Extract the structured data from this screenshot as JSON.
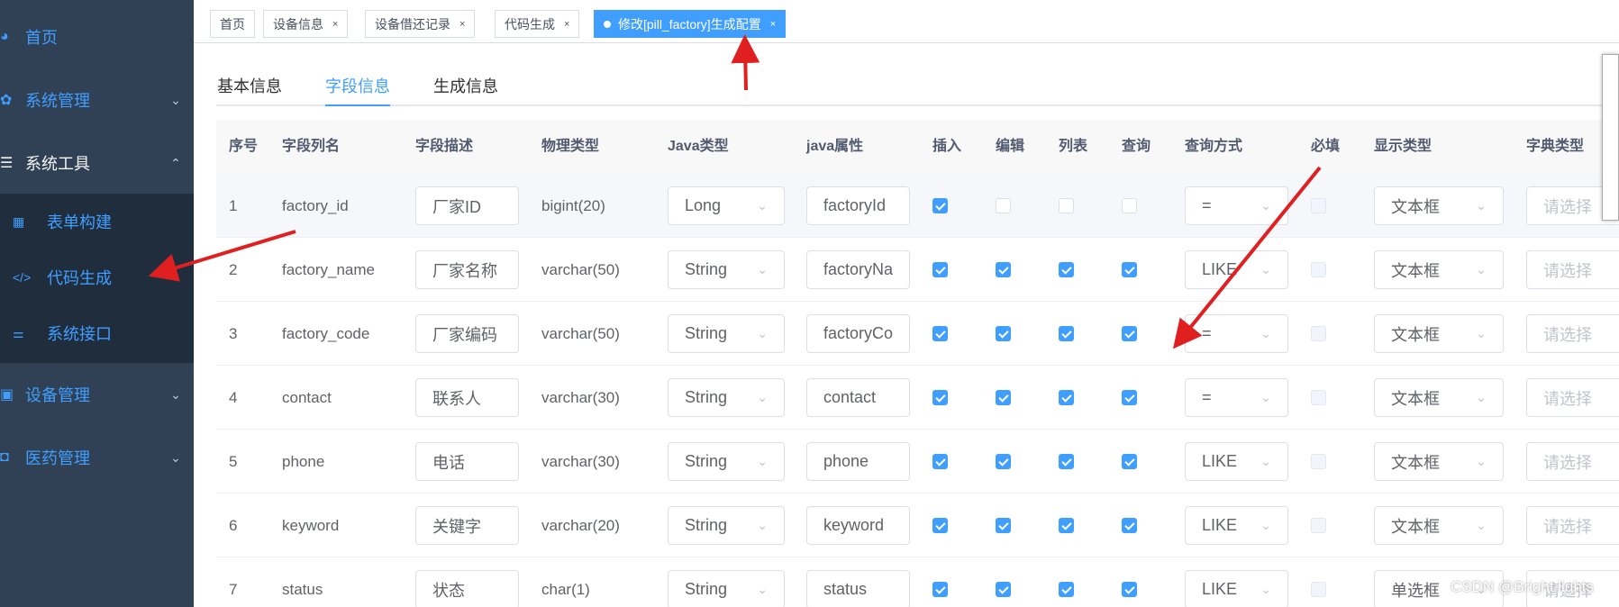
{
  "sidebar": {
    "items": [
      {
        "label": "首页",
        "icon": "dashboard-icon"
      },
      {
        "label": "系统管理",
        "icon": "gear-icon"
      },
      {
        "label": "系统工具",
        "icon": "list-icon"
      },
      {
        "label": "设备管理",
        "icon": "device-icon"
      },
      {
        "label": "医药管理",
        "icon": "medicine-icon"
      }
    ],
    "sub_items": [
      {
        "label": "表单构建",
        "icon": "grid-icon"
      },
      {
        "label": "代码生成",
        "icon": "code-icon"
      },
      {
        "label": "系统接口",
        "icon": "sliders-icon"
      }
    ]
  },
  "tags": [
    {
      "label": "首页"
    },
    {
      "label": "设备信息"
    },
    {
      "label": "设备借还记录"
    },
    {
      "label": "代码生成"
    },
    {
      "label": "修改[pill_factory]生成配置"
    }
  ],
  "tabs": [
    {
      "label": "基本信息"
    },
    {
      "label": "字段信息"
    },
    {
      "label": "生成信息"
    }
  ],
  "table": {
    "headers": [
      "序号",
      "字段列名",
      "字段描述",
      "物理类型",
      "Java类型",
      "java属性",
      "插入",
      "编辑",
      "列表",
      "查询",
      "查询方式",
      "必填",
      "显示类型",
      "字典类型"
    ],
    "rows": [
      {
        "no": "1",
        "column": "factory_id",
        "desc": "厂家ID",
        "phys": "bigint(20)",
        "jtype": "Long",
        "jattr": "factoryId",
        "insert": true,
        "edit": false,
        "list": false,
        "query": false,
        "qmode": "=",
        "required": false,
        "display": "文本框",
        "dict": "请选择"
      },
      {
        "no": "2",
        "column": "factory_name",
        "desc": "厂家名称",
        "phys": "varchar(50)",
        "jtype": "String",
        "jattr": "factoryNa",
        "insert": true,
        "edit": true,
        "list": true,
        "query": true,
        "qmode": "LIKE",
        "required": false,
        "display": "文本框",
        "dict": "请选择"
      },
      {
        "no": "3",
        "column": "factory_code",
        "desc": "厂家编码",
        "phys": "varchar(50)",
        "jtype": "String",
        "jattr": "factoryCo",
        "insert": true,
        "edit": true,
        "list": true,
        "query": true,
        "qmode": "=",
        "required": false,
        "display": "文本框",
        "dict": "请选择"
      },
      {
        "no": "4",
        "column": "contact",
        "desc": "联系人",
        "phys": "varchar(30)",
        "jtype": "String",
        "jattr": "contact",
        "insert": true,
        "edit": true,
        "list": true,
        "query": true,
        "qmode": "=",
        "required": false,
        "display": "文本框",
        "dict": "请选择"
      },
      {
        "no": "5",
        "column": "phone",
        "desc": "电话",
        "phys": "varchar(30)",
        "jtype": "String",
        "jattr": "phone",
        "insert": true,
        "edit": true,
        "list": true,
        "query": true,
        "qmode": "LIKE",
        "required": false,
        "display": "文本框",
        "dict": "请选择"
      },
      {
        "no": "6",
        "column": "keyword",
        "desc": "关键字",
        "phys": "varchar(20)",
        "jtype": "String",
        "jattr": "keyword",
        "insert": true,
        "edit": true,
        "list": true,
        "query": true,
        "qmode": "LIKE",
        "required": false,
        "display": "文本框",
        "dict": "请选择"
      },
      {
        "no": "7",
        "column": "status",
        "desc": "状态",
        "phys": "char(1)",
        "jtype": "String",
        "jattr": "status",
        "insert": true,
        "edit": true,
        "list": true,
        "query": true,
        "qmode": "LIKE",
        "required": false,
        "display": "单选框",
        "dict": "请选择"
      }
    ]
  },
  "watermark": "CSDN @Bright lights",
  "colors": {
    "sidebar_bg": "#304156",
    "accent": "#409eff",
    "annotation": "#e02020"
  }
}
